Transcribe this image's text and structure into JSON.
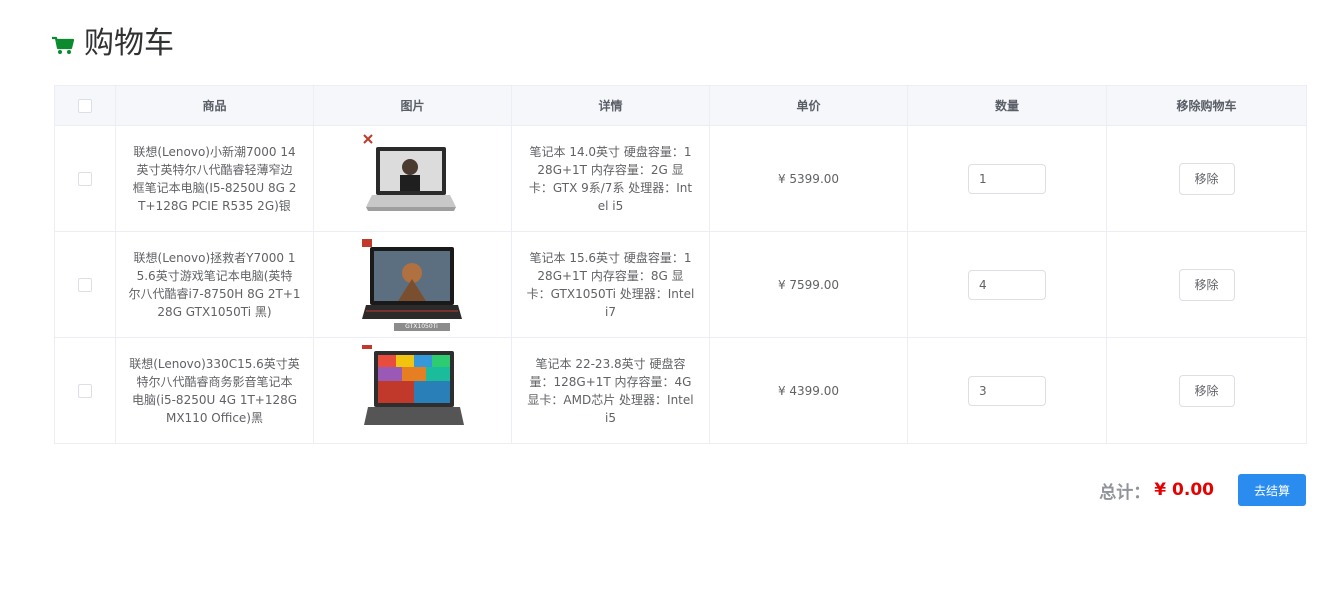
{
  "page": {
    "title": "购物车"
  },
  "table": {
    "headers": {
      "product": "商品",
      "image": "图片",
      "details": "详情",
      "unit_price": "单价",
      "quantity": "数量",
      "remove": "移除购物车"
    },
    "rows": [
      {
        "name_lines": [
          "联想(Lenovo)小新潮7000 14",
          "英寸英特尔八代酷睿轻薄窄边",
          "框笔记本电脑(I5-8250U 8G 2",
          "T+128G PCIE R535 2G)银"
        ],
        "detail_lines": [
          "笔记本 14.0英寸 硬盘容量：1",
          "28G+1T 内存容量：2G 显",
          "卡：GTX 9系/7系 处理器：Int",
          "el i5"
        ],
        "price": "¥ 5399.00",
        "quantity": "1",
        "remove_label": "移除"
      },
      {
        "name_lines": [
          "联想(Lenovo)拯救者Y7000 1",
          "5.6英寸游戏笔记本电脑(英特",
          "尔八代酷睿i7-8750H 8G 2T+1",
          "28G GTX1050Ti 黑)"
        ],
        "detail_lines": [
          "笔记本 15.6英寸 硬盘容量：1",
          "28G+1T 内存容量：8G 显",
          "卡：GTX1050Ti 处理器：Intel",
          "i7"
        ],
        "price": "¥ 7599.00",
        "quantity": "4",
        "remove_label": "移除",
        "image_tag": "GTX1050Ti"
      },
      {
        "name_lines": [
          "联想(Lenovo)330C15.6英寸英",
          "特尔八代酷睿商务影音笔记本",
          "电脑(i5-8250U 4G 1T+128G",
          "MX110 Office)黑"
        ],
        "detail_lines": [
          "笔记本 22-23.8英寸 硬盘容",
          "量：128G+1T 内存容量：4G",
          "显卡：AMD芯片 处理器：Intel",
          "i5"
        ],
        "price": "¥ 4399.00",
        "quantity": "3",
        "remove_label": "移除"
      }
    ]
  },
  "footer": {
    "total_label": "总计：",
    "total_value": "¥ 0.00",
    "checkout_label": "去结算"
  },
  "colors": {
    "accent": "#2b8cf0",
    "price_red": "#e60000",
    "cart_icon_green": "#0b8a2e"
  }
}
